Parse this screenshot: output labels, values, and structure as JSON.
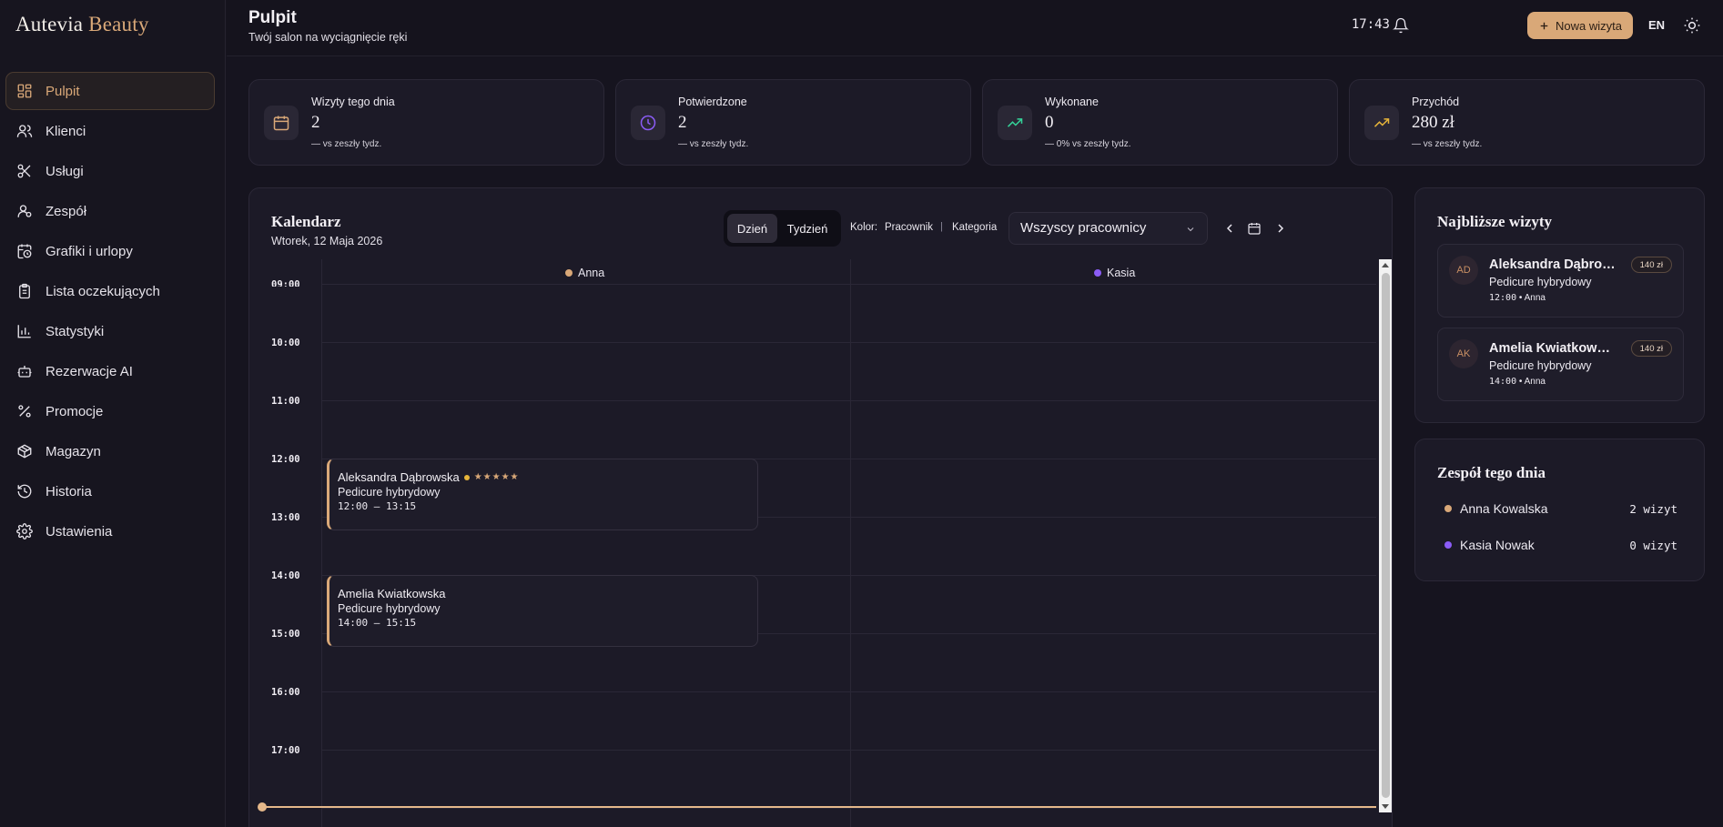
{
  "brand": {
    "part1": "Autevia",
    "part2": "Beauty"
  },
  "sidebar": {
    "items": [
      {
        "label": "Pulpit",
        "icon": "dashboard-icon"
      },
      {
        "label": "Klienci",
        "icon": "users-icon"
      },
      {
        "label": "Usługi",
        "icon": "scissors-icon"
      },
      {
        "label": "Zespół",
        "icon": "user-team-icon"
      },
      {
        "label": "Grafiki i urlopy",
        "icon": "calendar-clock-icon"
      },
      {
        "label": "Lista oczekujących",
        "icon": "clipboard-icon"
      },
      {
        "label": "Statystyki",
        "icon": "bar-chart-icon"
      },
      {
        "label": "Rezerwacje AI",
        "icon": "robot-icon"
      },
      {
        "label": "Promocje",
        "icon": "percent-icon"
      },
      {
        "label": "Magazyn",
        "icon": "package-icon"
      },
      {
        "label": "Historia",
        "icon": "history-icon"
      },
      {
        "label": "Ustawienia",
        "icon": "gear-icon"
      }
    ]
  },
  "header": {
    "title": "Pulpit",
    "subtitle": "Twój salon na wyciągnięcie ręki",
    "time": "17:43",
    "new_visit": "Nowa wizyta",
    "lang": "EN"
  },
  "stats": [
    {
      "label": "Wizyty tego dnia",
      "value": "2",
      "trend": "— vs zeszły tydz."
    },
    {
      "label": "Potwierdzone",
      "value": "2",
      "trend": "— vs zeszły tydz."
    },
    {
      "label": "Wykonane",
      "value": "0",
      "trend": "— 0% vs zeszły tydz."
    },
    {
      "label": "Przychód",
      "value": "280 zł",
      "trend": "— vs zeszły tydz."
    }
  ],
  "calendar": {
    "title": "Kalendarz",
    "date": "Wtorek, 12 Maja 2026",
    "view_day": "Dzień",
    "view_week": "Tydzień",
    "color_label": "Kolor:",
    "color_worker": "Pracownik",
    "color_sep": "|",
    "color_category": "Kategoria",
    "worker_filter": "Wszyscy pracownicy",
    "columns": [
      {
        "name": "Anna",
        "color": "#d9a878"
      },
      {
        "name": "Kasia",
        "color": "#8b5cf6"
      }
    ],
    "hours": [
      "09:00",
      "10:00",
      "11:00",
      "12:00",
      "13:00",
      "14:00",
      "15:00",
      "16:00",
      "17:00"
    ],
    "events": [
      {
        "name": "Aleksandra Dąbrowska",
        "stars": "★★★★★",
        "service": "Pedicure hybrydowy",
        "time": "12:00 – 13:15"
      },
      {
        "name": "Amelia Kwiatkowska",
        "service": "Pedicure hybrydowy",
        "time": "14:00 – 15:15"
      }
    ]
  },
  "upcoming": {
    "title": "Najbliższe wizyty",
    "items": [
      {
        "initials": "AD",
        "name": "Aleksandra Dąbrowska",
        "service": "Pedicure hybrydowy",
        "time": "12:00",
        "sep": "•",
        "worker": "Anna",
        "price": "140 zł"
      },
      {
        "initials": "AK",
        "name": "Amelia Kwiatkowska",
        "service": "Pedicure hybrydowy",
        "time": "14:00",
        "sep": "•",
        "worker": "Anna",
        "price": "140 zł"
      }
    ]
  },
  "team": {
    "title": "Zespół tego dnia",
    "members": [
      {
        "name": "Anna Kowalska",
        "count": "2 wizyt",
        "color": "#d9a878"
      },
      {
        "name": "Kasia Nowak",
        "count": "0 wizyt",
        "color": "#8b5cf6"
      }
    ]
  }
}
